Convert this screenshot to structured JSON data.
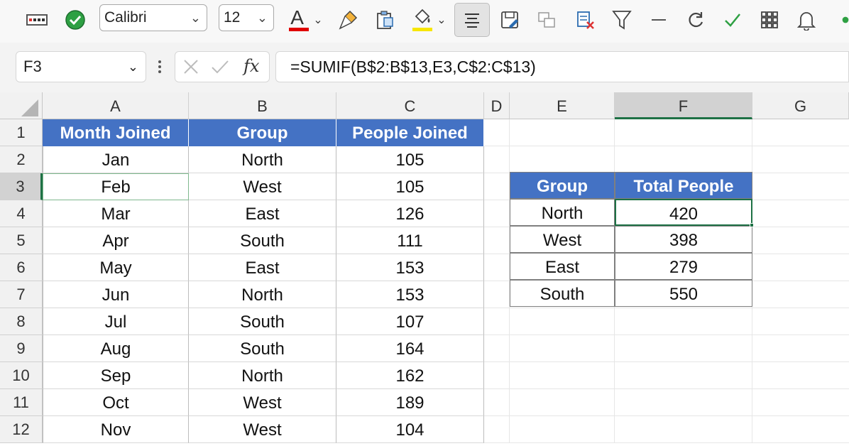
{
  "toolbar": {
    "font_name": "Calibri",
    "font_size": "12",
    "font_color_letter": "A",
    "icons": [
      "keyboard-icon",
      "check-circle-icon",
      "font-color-icon",
      "format-painter-icon",
      "paste-special-icon",
      "fill-color-icon",
      "align-center-icon",
      "save-as-icon",
      "copy-format-icon",
      "clear-filter-icon",
      "filter-icon",
      "minus-icon",
      "refresh-icon",
      "checkmark-icon",
      "grid-icon",
      "bell-icon"
    ],
    "colors": {
      "font_color": "#e00000",
      "fill_color": "#f7e600",
      "check_circle": "#2ea043"
    }
  },
  "formula_bar": {
    "name_box": "F3",
    "fx_label": "fx",
    "formula": "=SUMIF(B$2:B$13,E3,C$2:C$13)"
  },
  "columns": [
    "A",
    "B",
    "C",
    "D",
    "E",
    "F",
    "G"
  ],
  "rows": [
    "1",
    "2",
    "3",
    "4",
    "5",
    "6",
    "7",
    "8",
    "9",
    "10",
    "11",
    "12"
  ],
  "active_cell": {
    "column": "F",
    "row": "3"
  },
  "table1": {
    "headers": [
      "Month Joined",
      "Group",
      "People Joined"
    ],
    "rows": [
      [
        "Jan",
        "North",
        "105"
      ],
      [
        "Feb",
        "West",
        "105"
      ],
      [
        "Mar",
        "East",
        "126"
      ],
      [
        "Apr",
        "South",
        "111"
      ],
      [
        "May",
        "East",
        "153"
      ],
      [
        "Jun",
        "North",
        "153"
      ],
      [
        "Jul",
        "South",
        "107"
      ],
      [
        "Aug",
        "South",
        "164"
      ],
      [
        "Sep",
        "North",
        "162"
      ],
      [
        "Oct",
        "West",
        "189"
      ],
      [
        "Nov",
        "West",
        "104"
      ]
    ]
  },
  "table2": {
    "headers": [
      "Group",
      "Total People"
    ],
    "rows": [
      [
        "North",
        "420"
      ],
      [
        "West",
        "398"
      ],
      [
        "East",
        "279"
      ],
      [
        "South",
        "550"
      ]
    ]
  },
  "theme": {
    "header_fill": "#4472c4",
    "active_accent": "#1e7145"
  }
}
